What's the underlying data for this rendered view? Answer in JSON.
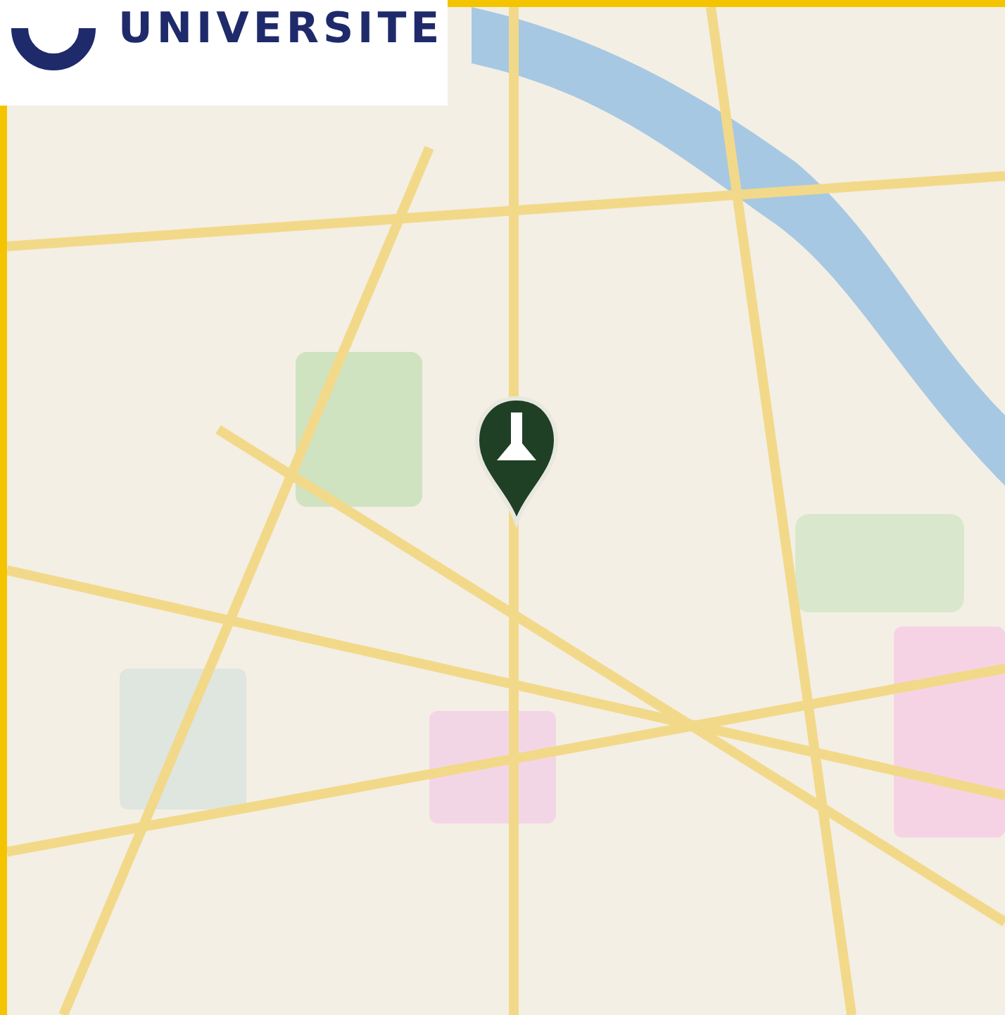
{
  "logo": {
    "text": "UNIVERSITE"
  }
}
